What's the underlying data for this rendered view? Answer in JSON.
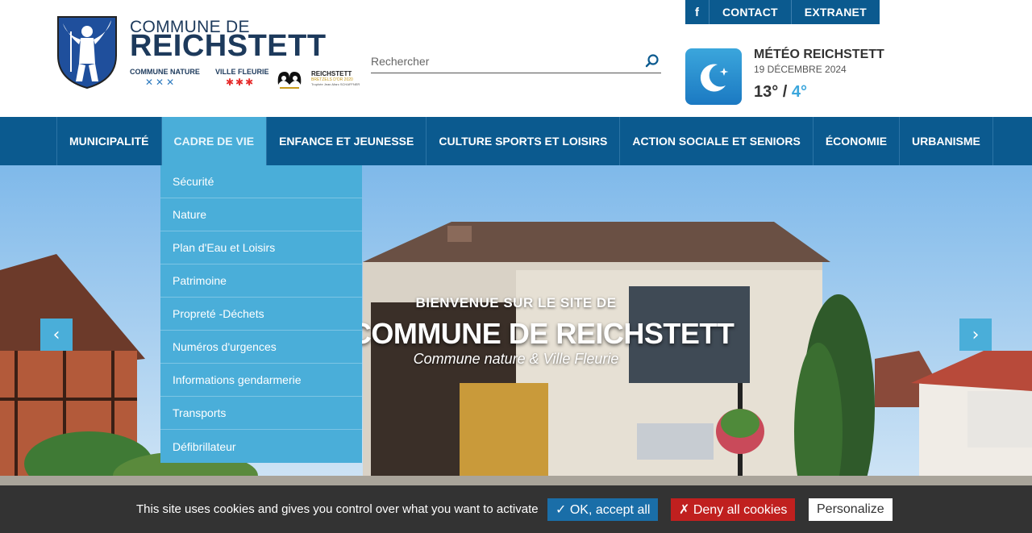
{
  "header": {
    "brand_line1": "COMMUNE DE",
    "brand_line2": "REICHSTETT",
    "label_nature": "COMMUNE NATURE",
    "label_fleurie": "VILLE FLEURIE",
    "bretzel_title": "REICHSTETT",
    "bretzel_sub": "BRETZELS D'OR 2020",
    "bretzel_sub2": "Trophée Jean-Marc SCHAFFNER"
  },
  "search": {
    "placeholder": "Rechercher"
  },
  "topbar": {
    "facebook": "f",
    "contact": "CONTACT",
    "extranet": "EXTRANET"
  },
  "weather": {
    "title": "MÉTÉO REICHSTETT",
    "date": "19 DÉCEMBRE 2024",
    "tmax": "13°",
    "separator": " / ",
    "tmin": "4°"
  },
  "nav": {
    "items": [
      {
        "label": "MUNICIPALITÉ"
      },
      {
        "label": "CADRE DE VIE"
      },
      {
        "label": "ENFANCE ET JEUNESSE"
      },
      {
        "label": "CULTURE SPORTS ET LOISIRS"
      },
      {
        "label": "ACTION SOCIALE ET SENIORS"
      },
      {
        "label": "ÉCONOMIE"
      },
      {
        "label": "URBANISME"
      }
    ],
    "active_index": 1
  },
  "dropdown": {
    "items": [
      "Sécurité",
      "Nature",
      "Plan d'Eau et Loisirs",
      "Patrimoine",
      "Propreté -Déchets",
      "Numéros d'urgences",
      "Informations gendarmerie",
      "Transports",
      "Défibrillateur"
    ]
  },
  "hero": {
    "kicker": "BIENVENUE SUR LE SITE DE",
    "title": "LA COMMUNE DE REICHSTETT",
    "subtitle": "Commune nature & Ville Fleurie",
    "prev": "‹",
    "next": "›"
  },
  "cookie": {
    "text": "This site uses cookies and gives you control over what you want to activate",
    "accept": "✓ OK, accept all",
    "deny": "✗ Deny all cookies",
    "personalize": "Personalize"
  },
  "colors": {
    "primary": "#0b5a8f",
    "accent": "#4aaed9",
    "cookie_bg": "#333333",
    "deny": "#c0201f"
  }
}
